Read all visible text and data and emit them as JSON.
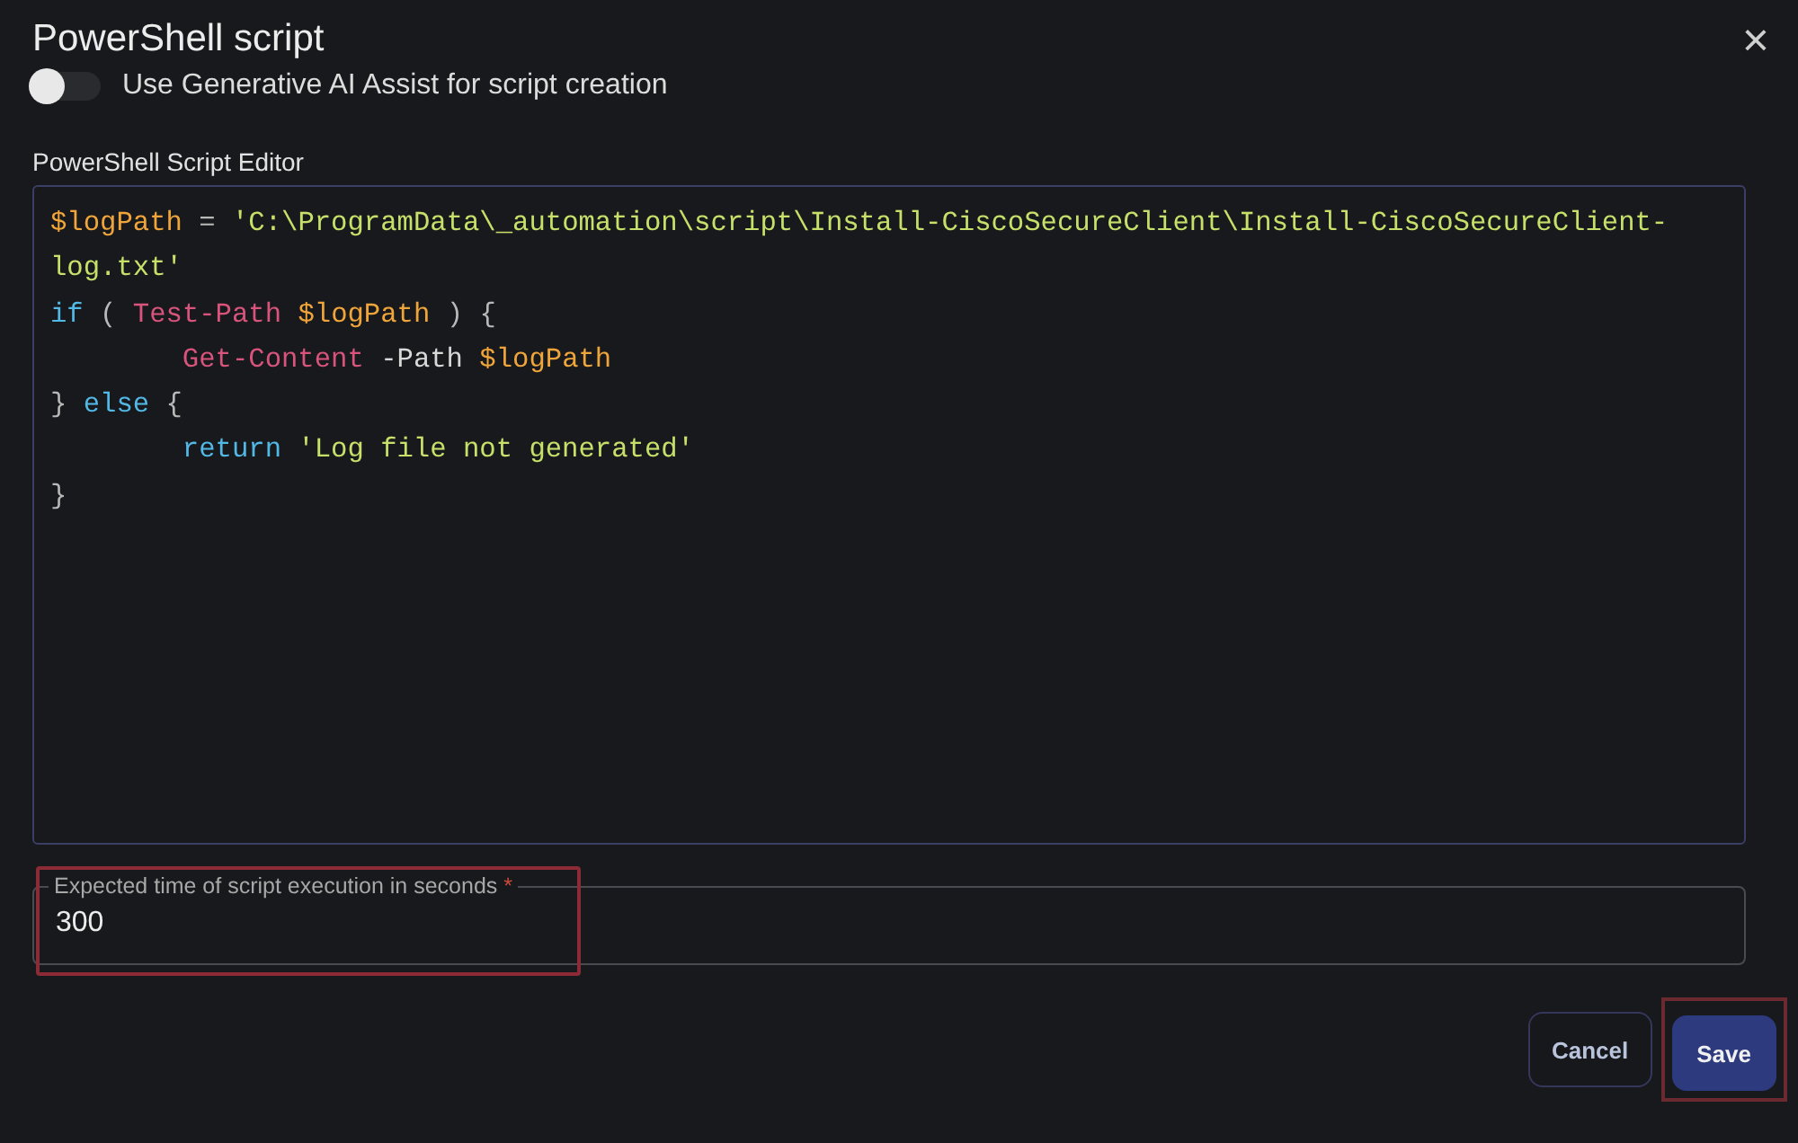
{
  "dialog": {
    "title": "PowerShell script",
    "close": "×"
  },
  "ai_toggle": {
    "label": "Use Generative AI Assist for script creation",
    "on": false
  },
  "editor": {
    "label": "PowerShell Script Editor",
    "lines": [
      [
        {
          "kind": "variable",
          "text": "$logPath"
        },
        {
          "kind": "plain",
          "text": " = "
        },
        {
          "kind": "string",
          "text": "'C:\\ProgramData\\_automation\\script\\Install-CiscoSecureClient\\Install-CiscoSecureClient-"
        }
      ],
      [
        {
          "kind": "string",
          "text": "log.txt'"
        }
      ],
      [
        {
          "kind": "keyword",
          "text": "if"
        },
        {
          "kind": "plain",
          "text": " ( "
        },
        {
          "kind": "command",
          "text": "Test-Path"
        },
        {
          "kind": "variable",
          "text": " $logPath"
        },
        {
          "kind": "plain",
          "text": " ) {"
        }
      ],
      [
        {
          "kind": "indent"
        },
        {
          "kind": "command",
          "text": "Get-Content"
        },
        {
          "kind": "param",
          "text": " -Path "
        },
        {
          "kind": "variable",
          "text": "$logPath"
        }
      ],
      [
        {
          "kind": "plain",
          "text": "} "
        },
        {
          "kind": "keyword",
          "text": "else"
        },
        {
          "kind": "plain",
          "text": " {"
        }
      ],
      [
        {
          "kind": "indent"
        },
        {
          "kind": "keyword",
          "text": "return"
        },
        {
          "kind": "string",
          "text": " 'Log file not generated'"
        }
      ],
      [
        {
          "kind": "plain",
          "text": "}"
        }
      ]
    ]
  },
  "timeout_field": {
    "label": "Expected time of script execution in seconds",
    "required_mark": "*",
    "value": "300",
    "highlighted": true
  },
  "buttons": [
    {
      "label": "Cancel",
      "kind": "secondary",
      "highlighted": false
    },
    {
      "label": "Save",
      "kind": "primary",
      "highlighted": true
    }
  ]
}
